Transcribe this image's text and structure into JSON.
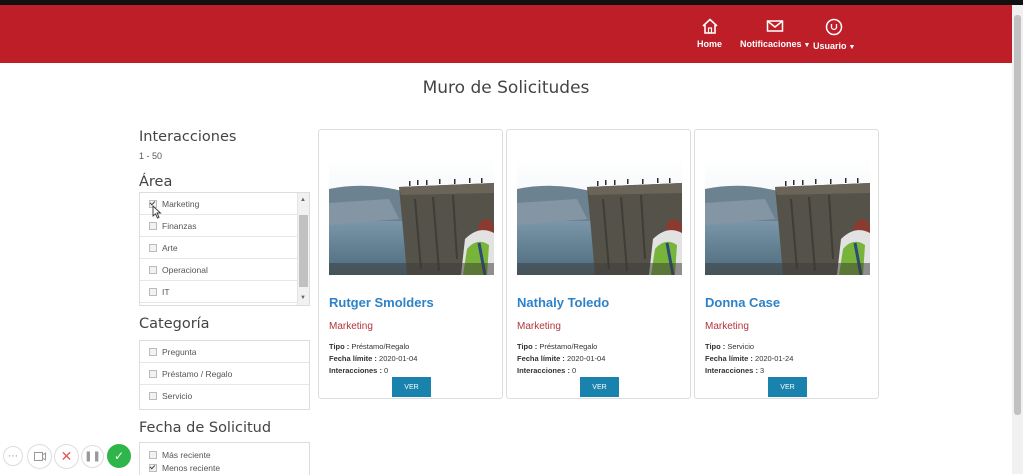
{
  "navbar": {
    "home_label": "Home",
    "notifications_label": "Notificaciones",
    "user_label": "Usuario",
    "bg_color": "#bd1e28"
  },
  "page": {
    "title": "Muro de Solicitudes"
  },
  "sidebar": {
    "interactions": {
      "heading": "Interacciones",
      "range": "1 - 50"
    },
    "area": {
      "heading": "Área",
      "items": [
        {
          "label": "Marketing",
          "checked": true
        },
        {
          "label": "Finanzas",
          "checked": false
        },
        {
          "label": "Arte",
          "checked": false
        },
        {
          "label": "Operacional",
          "checked": false
        },
        {
          "label": "IT",
          "checked": false
        }
      ]
    },
    "category": {
      "heading": "Categoría",
      "items": [
        {
          "label": "Pregunta",
          "checked": false
        },
        {
          "label": "Préstamo / Regalo",
          "checked": false
        },
        {
          "label": "Servicio",
          "checked": false
        }
      ]
    },
    "request_date": {
      "heading": "Fecha de Solicitud",
      "items": [
        {
          "label": "Más reciente",
          "checked": false
        },
        {
          "label": "Menos reciente",
          "checked": true
        }
      ]
    }
  },
  "labels": {
    "type": "Tipo :",
    "deadline": "Fecha límite :",
    "interactions": "Interacciones :",
    "view_button": "VER"
  },
  "cards": [
    {
      "name": "Rutger Smolders",
      "area": "Marketing",
      "type": "Préstamo/Regalo",
      "deadline": "2020-01-04",
      "interactions": "0"
    },
    {
      "name": "Nathaly Toledo",
      "area": "Marketing",
      "type": "Préstamo/Regalo",
      "deadline": "2020-01-04",
      "interactions": "0"
    },
    {
      "name": "Donna Case",
      "area": "Marketing",
      "type": "Servicio",
      "deadline": "2020-01-24",
      "interactions": "3"
    }
  ],
  "recorder_controls": {
    "icons": [
      "more-icon",
      "camera-icon",
      "close-icon",
      "pause-icon",
      "check-icon"
    ],
    "accent": "#2fb54a"
  }
}
